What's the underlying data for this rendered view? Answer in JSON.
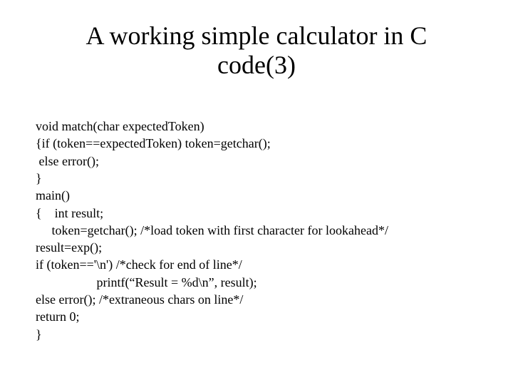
{
  "title_line1": "A working simple calculator in C",
  "title_line2": "code(3)",
  "code_lines": [
    "void match(char expectedToken)",
    "{if (token==expectedToken) token=getchar();",
    " else error();",
    "}",
    "main()",
    "{    int result;",
    "     token=getchar(); /*load token with first character for lookahead*/",
    "result=exp();",
    "if (token=='\\n') /*check for end of line*/",
    "                   printf(“Result = %d\\n”, result);",
    "else error(); /*extraneous chars on line*/",
    "return 0;",
    "}"
  ]
}
